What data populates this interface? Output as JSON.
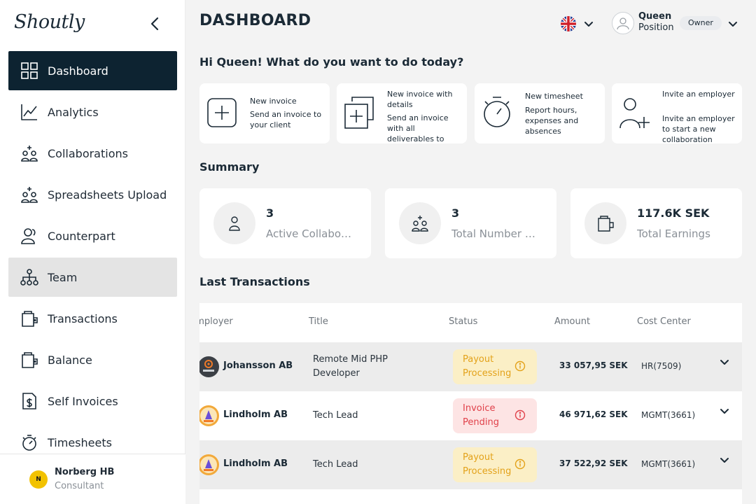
{
  "app": {
    "logo": "Shoutly"
  },
  "sidebar": {
    "items": [
      {
        "label": "Dashboard",
        "icon": "dashboard-grid-icon"
      },
      {
        "label": "Analytics",
        "icon": "analytics-chart-icon"
      },
      {
        "label": "Collaborations",
        "icon": "collaborations-icon"
      },
      {
        "label": "Spreadsheets Upload",
        "icon": "spreadsheet-upload-icon"
      },
      {
        "label": "Counterpart",
        "icon": "counterpart-icon"
      },
      {
        "label": "Team",
        "icon": "team-tree-icon"
      },
      {
        "label": "Transactions",
        "icon": "transactions-wallet-icon"
      },
      {
        "label": "Balance",
        "icon": "balance-wallet-icon"
      },
      {
        "label": "Self Invoices",
        "icon": "self-invoice-dollar-icon"
      },
      {
        "label": "Timesheets",
        "icon": "stopwatch-icon"
      }
    ],
    "footer": {
      "name": "Norberg HB",
      "role": "Consultant",
      "avatar_text": "N"
    }
  },
  "header": {
    "title": "DASHBOARD",
    "language_flag": "uk-flag-icon",
    "user": {
      "name": "Queen",
      "position": "Position",
      "role": "Owner"
    }
  },
  "greeting": "Hi Queen! What do you want to do today?",
  "actions": [
    {
      "title": "New invoice",
      "description": "Send an invoice to your client"
    },
    {
      "title": "New invoice with details",
      "description": "Send an invoice with all deliverables to"
    },
    {
      "title": "New timesheet",
      "description": "Report hours, expenses and absences"
    },
    {
      "title": "Invite an employer",
      "description": "Invite an employer to start a new collaboration"
    }
  ],
  "summary": {
    "title": "Summary",
    "cards": [
      {
        "value": "3",
        "label": "Active Collaborations"
      },
      {
        "value": "3",
        "label": "Total Number of Employers"
      },
      {
        "value": "117.6K SEK",
        "label": "Total Earnings"
      }
    ]
  },
  "transactions": {
    "title": "Last Transactions",
    "columns": {
      "employer": "Employer",
      "title": "Title",
      "status": "Status",
      "amount": "Amount",
      "cost_center": "Cost Center"
    },
    "rows": [
      {
        "employer": "Johansson AB",
        "title": "Remote Mid PHP Developer",
        "status": "Payout Processing",
        "amount": "33 057,95 SEK",
        "cost_center": "HR(7509)"
      },
      {
        "employer": "Lindholm AB",
        "title": "Tech Lead",
        "status": "Invoice Pending",
        "amount": "46 971,62 SEK",
        "cost_center": "MGMT(3661)"
      },
      {
        "employer": "Lindholm AB",
        "title": "Tech Lead",
        "status": "Payout Processing",
        "amount": "37 522,92 SEK",
        "cost_center": "MGMT(3661)"
      }
    ]
  },
  "colors": {
    "sidebar_active": "#0d2331",
    "status_processing_bg": "#fbefc6",
    "status_processing_text": "#e3a21a",
    "status_pending_bg": "#fde4e4",
    "status_pending_text": "#e0414a"
  }
}
